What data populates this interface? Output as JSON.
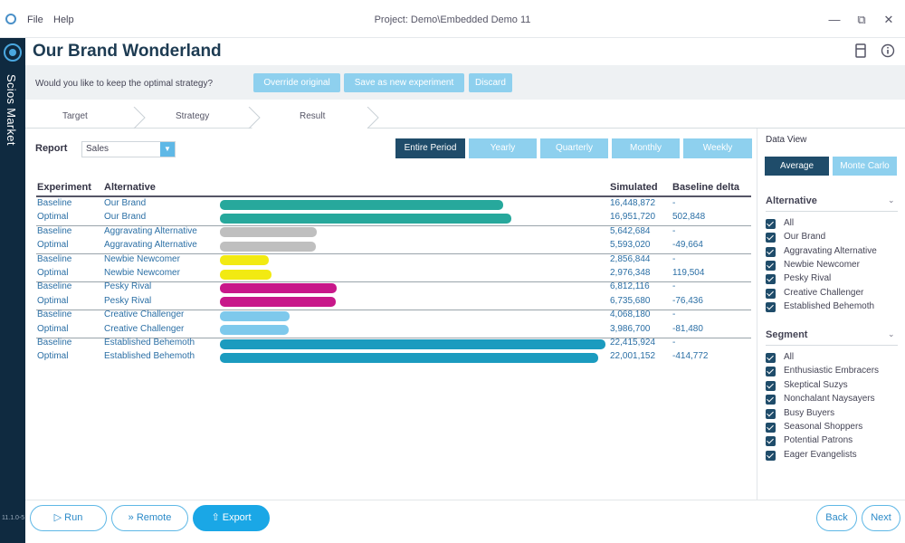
{
  "menu": {
    "file": "File",
    "help": "Help"
  },
  "window": {
    "project_title": "Project: Demo\\Embedded Demo 11",
    "minimize": "—",
    "restore": "⧉",
    "close": "✕"
  },
  "sidebar": {
    "app_name": "Scios Market",
    "version": "11.1.0-5"
  },
  "header": {
    "title": "Our Brand Wonderland"
  },
  "prompt": {
    "question": "Would you like to keep the optimal strategy?",
    "override": "Override original",
    "save_new": "Save as new experiment",
    "discard": "Discard"
  },
  "steps": [
    "Target",
    "Strategy",
    "Result"
  ],
  "report": {
    "label": "Report",
    "selected": "Sales",
    "caret": "▼"
  },
  "periods": [
    "Entire Period",
    "Yearly",
    "Quarterly",
    "Monthly",
    "Weekly"
  ],
  "table": {
    "headers": {
      "experiment": "Experiment",
      "alternative": "Alternative",
      "simulated": "Simulated",
      "delta": "Baseline delta"
    },
    "rows": [
      {
        "experiment": "Baseline",
        "alternative": "Our Brand",
        "simulated": "16,448,872",
        "delta": "-"
      },
      {
        "experiment": "Optimal",
        "alternative": "Our Brand",
        "simulated": "16,951,720",
        "delta": "502,848"
      },
      {
        "experiment": "Baseline",
        "alternative": "Aggravating Alternative",
        "simulated": "5,642,684",
        "delta": "-"
      },
      {
        "experiment": "Optimal",
        "alternative": "Aggravating Alternative",
        "simulated": "5,593,020",
        "delta": "-49,664"
      },
      {
        "experiment": "Baseline",
        "alternative": "Newbie Newcomer",
        "simulated": "2,856,844",
        "delta": "-"
      },
      {
        "experiment": "Optimal",
        "alternative": "Newbie Newcomer",
        "simulated": "2,976,348",
        "delta": "119,504"
      },
      {
        "experiment": "Baseline",
        "alternative": "Pesky Rival",
        "simulated": "6,812,116",
        "delta": "-"
      },
      {
        "experiment": "Optimal",
        "alternative": "Pesky Rival",
        "simulated": "6,735,680",
        "delta": "-76,436"
      },
      {
        "experiment": "Baseline",
        "alternative": "Creative Challenger",
        "simulated": "4,068,180",
        "delta": "-"
      },
      {
        "experiment": "Optimal",
        "alternative": "Creative Challenger",
        "simulated": "3,986,700",
        "delta": "-81,480"
      },
      {
        "experiment": "Baseline",
        "alternative": "Established Behemoth",
        "simulated": "22,415,924",
        "delta": "-"
      },
      {
        "experiment": "Optimal",
        "alternative": "Established Behemoth",
        "simulated": "22,001,152",
        "delta": "-414,772"
      }
    ]
  },
  "bar_colors": {
    "Our Brand": "#27a89c",
    "Aggravating Alternative": "#bfbfbf",
    "Newbie Newcomer": "#f2ea12",
    "Pesky Rival": "#c8188a",
    "Creative Challenger": "#7ec9ec",
    "Established Behemoth": "#1b9bbf"
  },
  "data_view": {
    "label": "Data View",
    "average": "Average",
    "monte_carlo": "Monte Carlo"
  },
  "alternative_filter": {
    "title": "Alternative",
    "chevron": "⌄",
    "items": [
      "All",
      "Our Brand",
      "Aggravating Alternative",
      "Newbie Newcomer",
      "Pesky Rival",
      "Creative Challenger",
      "Established Behemoth"
    ]
  },
  "segment_filter": {
    "title": "Segment",
    "chevron": "⌄",
    "items": [
      "All",
      "Enthusiastic Embracers",
      "Skeptical Suzys",
      "Nonchalant Naysayers",
      "Busy Buyers",
      "Seasonal Shoppers",
      "Potential Patrons",
      "Eager Evangelists"
    ]
  },
  "footer": {
    "run": "▷  Run",
    "remote": "»  Remote",
    "export": "⇧  Export",
    "back": "Back",
    "next": "Next"
  }
}
